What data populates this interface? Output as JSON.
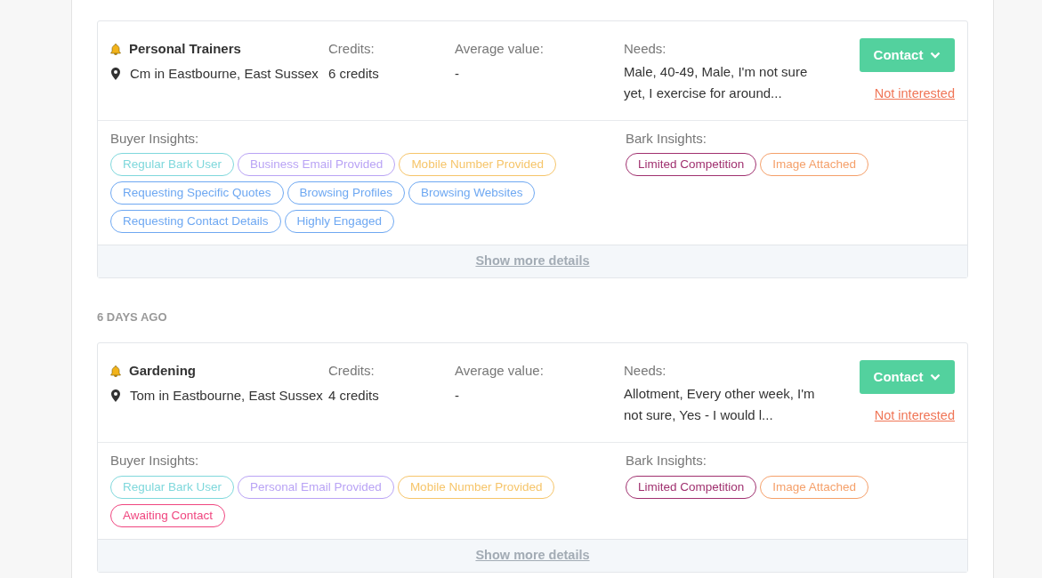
{
  "leads": [
    {
      "title": "Personal Trainers",
      "location": "Cm in Eastbourne, East Sussex",
      "credits_label": "Credits:",
      "credits": "6 credits",
      "average_label": "Average value:",
      "average": "-",
      "needs_label": "Needs:",
      "needs": "Male, 40-49, Male, I'm not sure yet, I exercise for around...",
      "contact_button": "Contact",
      "not_interested": "Not interested",
      "buyer_label": "Buyer Insights:",
      "buyer_tags": [
        {
          "label": "Regular Bark User",
          "color": "#7fd8dc"
        },
        {
          "label": "Business Email Provided",
          "color": "#b9a3f5"
        },
        {
          "label": "Mobile Number Provided",
          "color": "#f6c56a"
        },
        {
          "label": "Requesting Specific Quotes",
          "color": "#6ea8f2"
        },
        {
          "label": "Browsing Profiles",
          "color": "#6ea8f2"
        },
        {
          "label": "Browsing Websites",
          "color": "#6ea8f2"
        },
        {
          "label": "Requesting Contact Details",
          "color": "#6ea8f2"
        },
        {
          "label": "Highly Engaged",
          "color": "#6ea8f2"
        }
      ],
      "bark_label": "Bark Insights:",
      "bark_tags": [
        {
          "label": "Limited Competition",
          "color": "#a0306f"
        },
        {
          "label": "Image Attached",
          "color": "#f5a06a"
        }
      ],
      "more": "Show more details"
    },
    {
      "date_heading": "6 DAYS AGO",
      "title": "Gardening",
      "location": "Tom in Eastbourne, East Sussex",
      "credits_label": "Credits:",
      "credits": "4 credits",
      "average_label": "Average value:",
      "average": "-",
      "needs_label": "Needs:",
      "needs": "Allotment, Every other week, I'm not sure, Yes - I would l...",
      "contact_button": "Contact",
      "not_interested": "Not interested",
      "buyer_label": "Buyer Insights:",
      "buyer_tags": [
        {
          "label": "Regular Bark User",
          "color": "#7fd8dc"
        },
        {
          "label": "Personal Email Provided",
          "color": "#b9a3f5"
        },
        {
          "label": "Mobile Number Provided",
          "color": "#f6c56a"
        },
        {
          "label": "Awaiting Contact",
          "color": "#f0457f"
        }
      ],
      "bark_label": "Bark Insights:",
      "bark_tags": [
        {
          "label": "Limited Competition",
          "color": "#a0306f"
        },
        {
          "label": "Image Attached",
          "color": "#f5a06a"
        }
      ],
      "more": "Show more details"
    }
  ]
}
